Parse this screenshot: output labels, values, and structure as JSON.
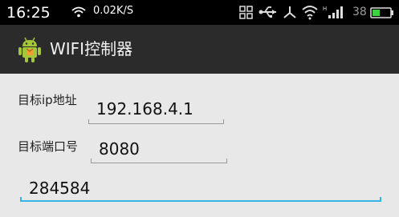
{
  "status_bar": {
    "time": "16:25",
    "network_speed": "0.02K/S",
    "battery_level": "38",
    "icons": [
      "wifi-icon",
      "grid-icon",
      "usb-icon",
      "share-icon",
      "wifi-icon",
      "signal-icon",
      "battery-icon"
    ]
  },
  "action_bar": {
    "title": "WIFI控制器",
    "icon": "android-icon"
  },
  "form": {
    "ip_label": "目标ip地址",
    "ip_value": "192.168.4.1",
    "port_label": "目标端口号",
    "port_value": "8080",
    "message_value": "284584"
  },
  "colors": {
    "status_bar_bg": "#000000",
    "action_bar_bg": "#2b2b2b",
    "content_bg": "#e8e8e8",
    "accent": "#33b5e5",
    "android_green": "#a4c639",
    "battery_green": "#3fd23f"
  }
}
